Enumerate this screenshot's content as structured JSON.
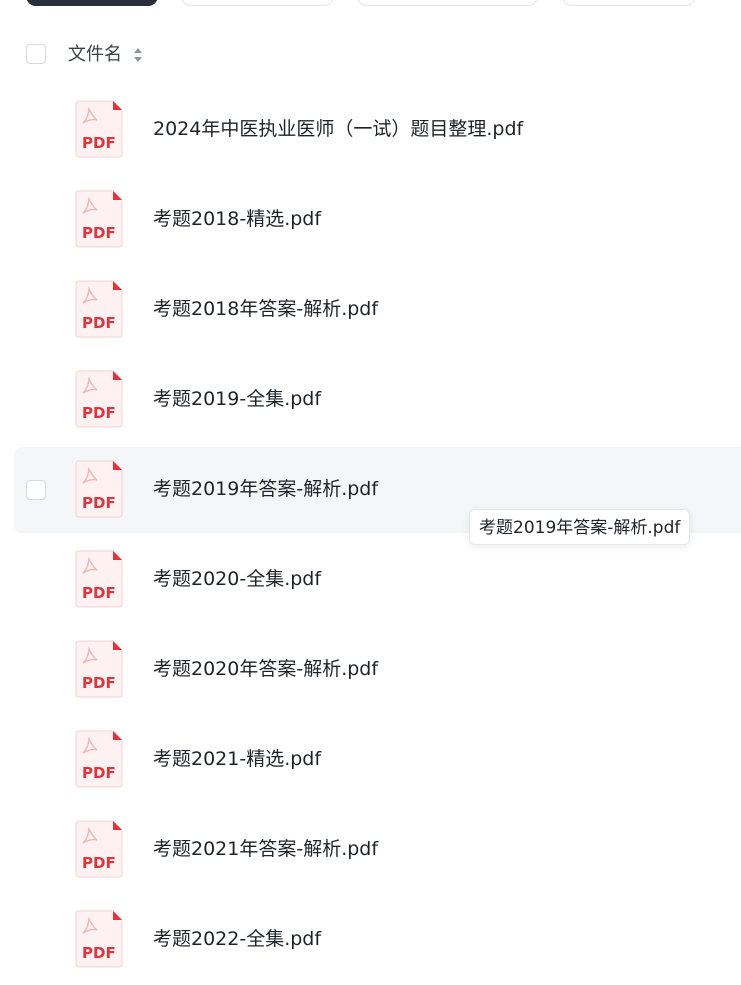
{
  "header": {
    "column_label": "文件名"
  },
  "file_icon_label": "PDF",
  "files": [
    {
      "name": "2024年中医执业医师（一试）题目整理.pdf"
    },
    {
      "name": "考题2018-精选.pdf"
    },
    {
      "name": "考题2018年答案-解析.pdf"
    },
    {
      "name": "考题2019-全集.pdf"
    },
    {
      "name": "考题2019年答案-解析.pdf"
    },
    {
      "name": "考题2020-全集.pdf"
    },
    {
      "name": "考题2020年答案-解析.pdf"
    },
    {
      "name": "考题2021-精选.pdf"
    },
    {
      "name": "考题2021年答案-解析.pdf"
    },
    {
      "name": "考题2022-全集.pdf"
    }
  ],
  "tooltip": {
    "text": "考题2019年答案-解析.pdf"
  },
  "colors": {
    "pdf_red": "#d9363e",
    "primary_button": "#2b2e3b",
    "hover_row": "#f5f6f7"
  }
}
